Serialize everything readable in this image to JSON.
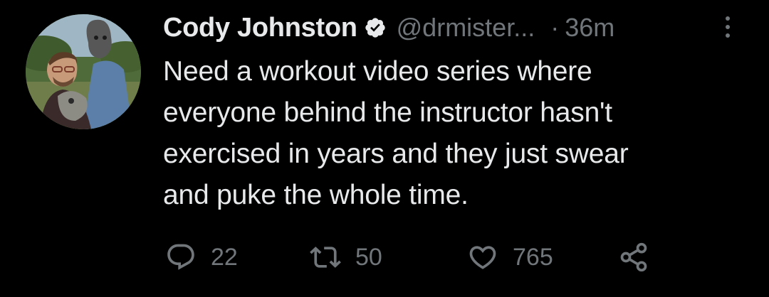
{
  "tweet": {
    "author": {
      "name": "Cody Johnston",
      "handle": "@drmister...",
      "verified_icon": "verified-badge-icon"
    },
    "separator": "·",
    "time": "36m",
    "text_lines": [
      "Need a workout video series where",
      "everyone behind the instructor hasn't",
      "exercised in years and they just swear",
      "and puke the whole time."
    ],
    "actions": {
      "reply_count": "22",
      "retweet_count": "50",
      "like_count": "765"
    }
  },
  "colors": {
    "background": "#000000",
    "primary_text": "#e7e9ea",
    "secondary_text": "#71767b",
    "verified_badge": "#e7e9ea"
  }
}
